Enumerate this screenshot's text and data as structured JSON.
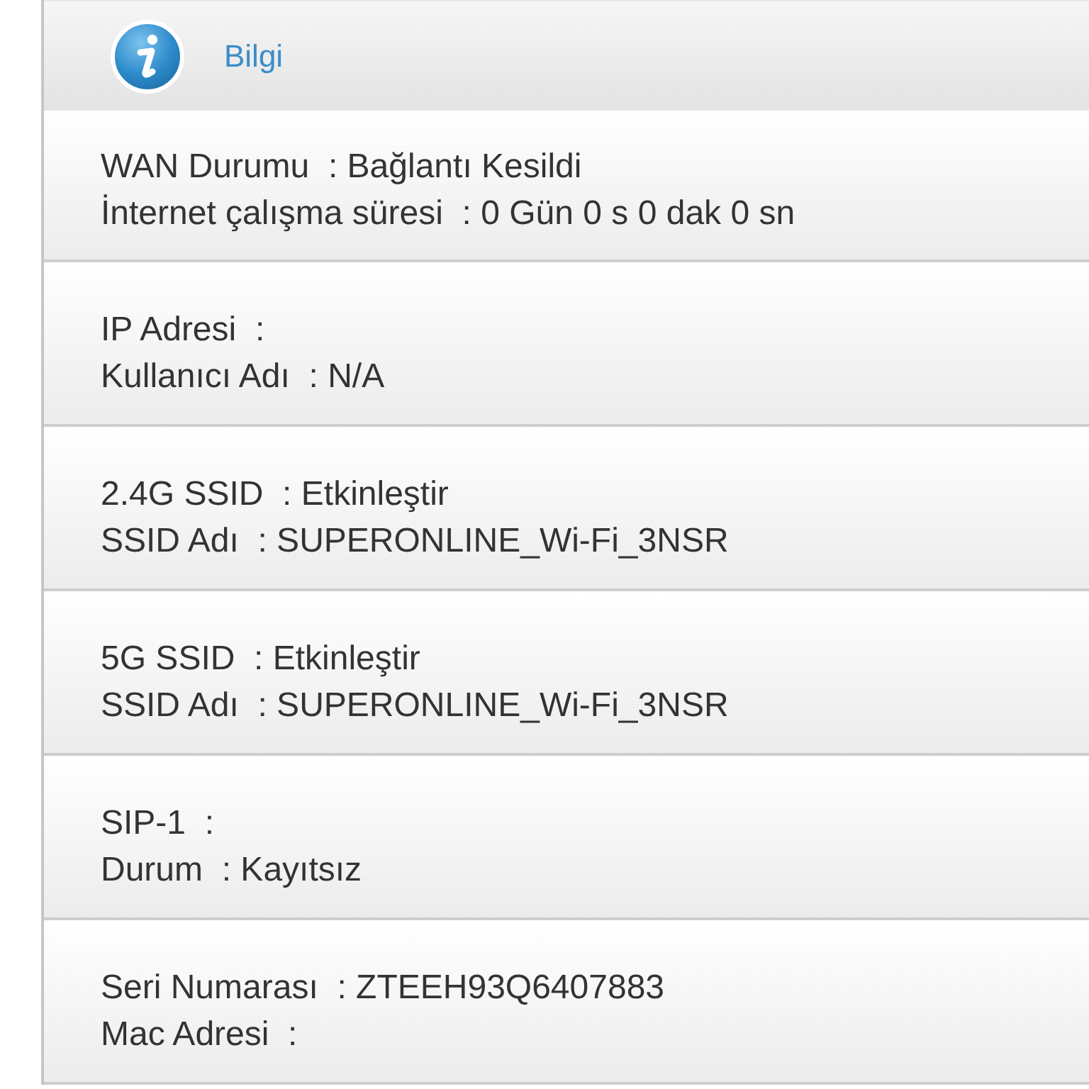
{
  "header": {
    "title": "Bilgi"
  },
  "sections": [
    {
      "lines": [
        "WAN Durumu  : Bağlantı Kesildi",
        "İnternet çalışma süresi  : 0 Gün 0 s 0 dak 0 sn"
      ]
    },
    {
      "lines": [
        "IP Adresi  :",
        "Kullanıcı Adı  : N/A"
      ]
    },
    {
      "lines": [
        "2.4G SSID  : Etkinleştir",
        "SSID Adı  : SUPERONLINE_Wi-Fi_3NSR"
      ]
    },
    {
      "lines": [
        "5G SSID  : Etkinleştir",
        "SSID Adı  : SUPERONLINE_Wi-Fi_3NSR"
      ]
    },
    {
      "lines": [
        "SIP-1  :",
        "Durum  : Kayıtsız"
      ]
    },
    {
      "lines": [
        "Seri Numarası  : ZTEEH93Q6407883",
        "Mac Adresi  :"
      ]
    }
  ]
}
